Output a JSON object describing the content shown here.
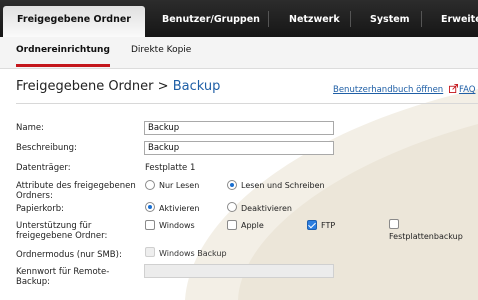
{
  "topnav": {
    "tabs": [
      "Freigegebene Ordner",
      "Benutzer/Gruppen",
      "Netzwerk",
      "System",
      "Erweitert"
    ]
  },
  "subnav": {
    "tabs": [
      "Ordnereinrichtung",
      "Direkte Kopie"
    ]
  },
  "header": {
    "title": "Freigegebene Ordner",
    "separator": ">",
    "crumb": "Backup",
    "help_link": "Benutzerhandbuch öffnen",
    "faq_link": "FAQ"
  },
  "form": {
    "name_label": "Name:",
    "name_value": "Backup",
    "description_label": "Beschreibung:",
    "description_value": "Backup",
    "volume_label": "Datenträger:",
    "volume_value": "Festplatte 1",
    "attributes_label": "Attribute des freigegebenen Ordners:",
    "attributes_options": [
      "Nur Lesen",
      "Lesen und Schreiben"
    ],
    "attributes_selected": "Lesen und Schreiben",
    "recycle_label": "Papierkorb:",
    "recycle_options": [
      "Aktivieren",
      "Deaktivieren"
    ],
    "recycle_selected": "Aktivieren",
    "support_label": "Unterstützung für freigegebene Ordner:",
    "support_options": [
      "Windows",
      "Apple",
      "FTP",
      "Festplattenbackup"
    ],
    "support_checked": [
      "FTP"
    ],
    "mode_label": "Ordnermodus (nur SMB):",
    "mode_option": "Windows Backup",
    "remote_password_label": "Kennwort für Remote-Backup:",
    "remote_password_value": ""
  },
  "colors": {
    "accent": "#c4161c",
    "link": "#1f5fa6",
    "nav_bg": "#1e1e1e"
  }
}
